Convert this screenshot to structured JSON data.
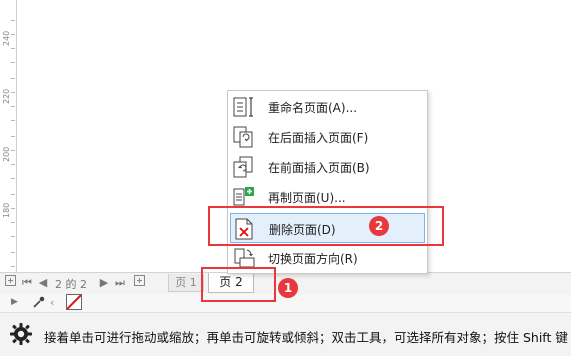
{
  "ruler": {
    "labels": [
      "240",
      "220",
      "200",
      "180"
    ]
  },
  "context_menu": {
    "items": [
      {
        "label": "重命名页面(A)...",
        "icon": "rename-page-icon"
      },
      {
        "label": "在后面插入页面(F)",
        "icon": "insert-page-after-icon"
      },
      {
        "label": "在前面插入页面(B)",
        "icon": "insert-page-before-icon"
      },
      {
        "label": "再制页面(U)...",
        "icon": "duplicate-page-icon"
      },
      {
        "label": "删除页面(D)",
        "icon": "delete-page-icon",
        "highlighted": true
      },
      {
        "label": "切换页面方向(R)",
        "icon": "switch-orientation-icon"
      }
    ]
  },
  "page_nav": {
    "first": "⏮",
    "prev": "◀",
    "counter": "2 的 2",
    "next": "▶",
    "last": "⏭",
    "tabs": [
      {
        "label": "页 1",
        "active": false
      },
      {
        "label": "页 2",
        "active": true
      }
    ]
  },
  "annotations": {
    "badge_1": "1",
    "badge_2": "2",
    "color": "#e8383d"
  },
  "status": {
    "text": "接着单击可进行拖动或缩放；再单击可旋转或倾斜；双击工具，可选择所有对象；按住 Shift 键"
  }
}
